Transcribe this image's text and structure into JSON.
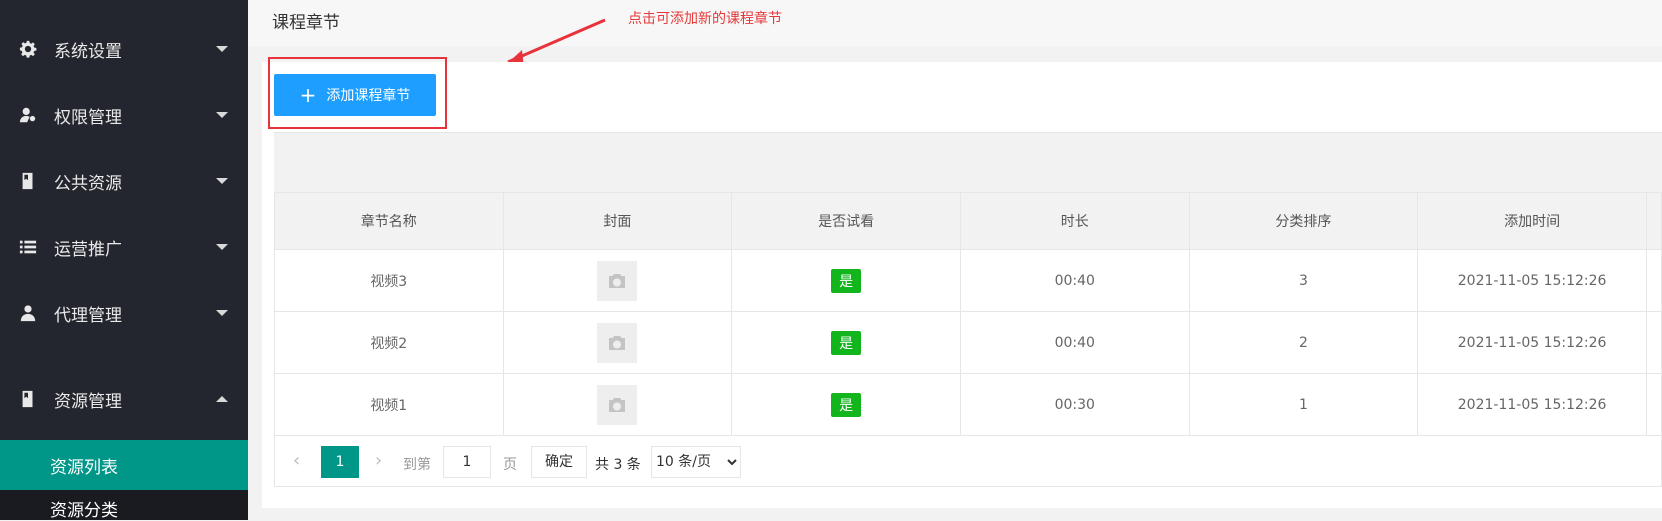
{
  "sidebar": {
    "items": [
      {
        "label": "系统设置",
        "icon": "gear-icon",
        "expanded": false
      },
      {
        "label": "权限管理",
        "icon": "user-key-icon",
        "expanded": false
      },
      {
        "label": "公共资源",
        "icon": "book-icon",
        "expanded": false
      },
      {
        "label": "运营推广",
        "icon": "list-icon",
        "expanded": false
      },
      {
        "label": "代理管理",
        "icon": "user-icon",
        "expanded": false
      },
      {
        "label": "资源管理",
        "icon": "book-icon",
        "expanded": true
      }
    ],
    "subitems": [
      {
        "label": "资源列表",
        "active": true
      },
      {
        "label": "资源分类",
        "active": false
      }
    ]
  },
  "header": {
    "title": "课程章节"
  },
  "annotation": {
    "text": "点击可添加新的课程章节",
    "color": "#e43a3a"
  },
  "toolbar": {
    "add_label": "添加课程章节"
  },
  "table": {
    "columns": [
      "章节名称",
      "封面",
      "是否试看",
      "时长",
      "分类排序",
      "添加时间"
    ],
    "rows": [
      {
        "name": "视频3",
        "trial": "是",
        "duration": "00:40",
        "sort": "3",
        "added": "2021-11-05 15:12:26"
      },
      {
        "name": "视频2",
        "trial": "是",
        "duration": "00:40",
        "sort": "2",
        "added": "2021-11-05 15:12:26"
      },
      {
        "name": "视频1",
        "trial": "是",
        "duration": "00:30",
        "sort": "1",
        "added": "2021-11-05 15:12:26"
      }
    ]
  },
  "pagination": {
    "current_page": "1",
    "goto_label": "到第",
    "goto_value": "1",
    "page_label": "页",
    "confirm_label": "确定",
    "total_label": "共 3 条",
    "page_size": "10 条/页"
  },
  "colors": {
    "accent": "#009688",
    "button": "#1e9fff",
    "badge": "#13b51c",
    "sidebar": "#23262e"
  }
}
